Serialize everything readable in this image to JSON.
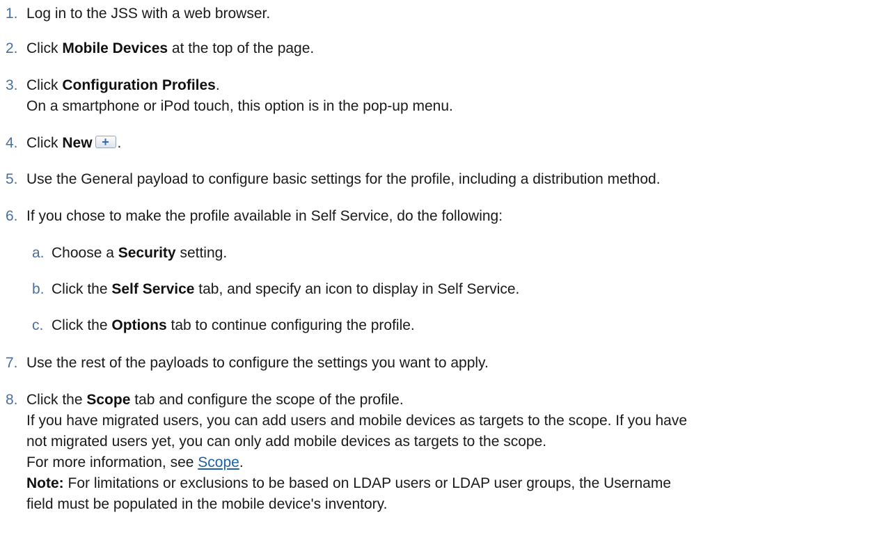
{
  "steps": {
    "s1": {
      "num": "1.",
      "pre": "Log in to the JSS with a web browser."
    },
    "s2": {
      "num": "2.",
      "pre": "Click ",
      "bold": "Mobile Devices",
      "post": " at the top of the page."
    },
    "s3": {
      "num": "3.",
      "pre": "Click ",
      "bold": "Configuration Profiles",
      "post": ".",
      "note": "On a smartphone or iPod touch, this option is in the pop-up menu."
    },
    "s4": {
      "num": "4.",
      "pre": "Click ",
      "bold": "New",
      "button_glyph": "+",
      "post": "."
    },
    "s5": {
      "num": "5.",
      "pre": "Use the General payload to configure basic settings for the profile, including a distribution method."
    },
    "s6": {
      "num": "6.",
      "pre": "If you chose to make the profile available in Self Service, do the following:"
    },
    "s6a": {
      "num": "a.",
      "pre": "Choose a ",
      "bold": "Security",
      "post": " setting."
    },
    "s6b": {
      "num": "b.",
      "pre": "Click the ",
      "bold": "Self Service",
      "post": " tab, and specify an icon to display in Self Service."
    },
    "s6c": {
      "num": "c.",
      "pre": "Click the ",
      "bold": "Options",
      "post": " tab to continue configuring the profile."
    },
    "s7": {
      "num": "7.",
      "pre": "Use the rest of the payloads to configure the settings you want to apply."
    },
    "s8": {
      "num": "8.",
      "pre": "Click the ",
      "bold": "Scope",
      "post": " tab and configure the scope of the profile.",
      "line2": "If you have migrated users, you can add users and mobile devices as targets to the scope. If you have",
      "line3": "not migrated users yet, you can only add mobile devices as targets to the scope.",
      "more_pre": "For more information, see ",
      "more_link": "Scope",
      "more_post": ".",
      "note_label": "Note:",
      "note_text": " For limitations or exclusions to be based on LDAP users or LDAP user groups, the Username",
      "note_line2": "field must be populated in the mobile device's inventory."
    }
  },
  "colors": {
    "number": "#4a6f9e",
    "link": "#1f5fa6",
    "text": "#1a1a1a"
  }
}
